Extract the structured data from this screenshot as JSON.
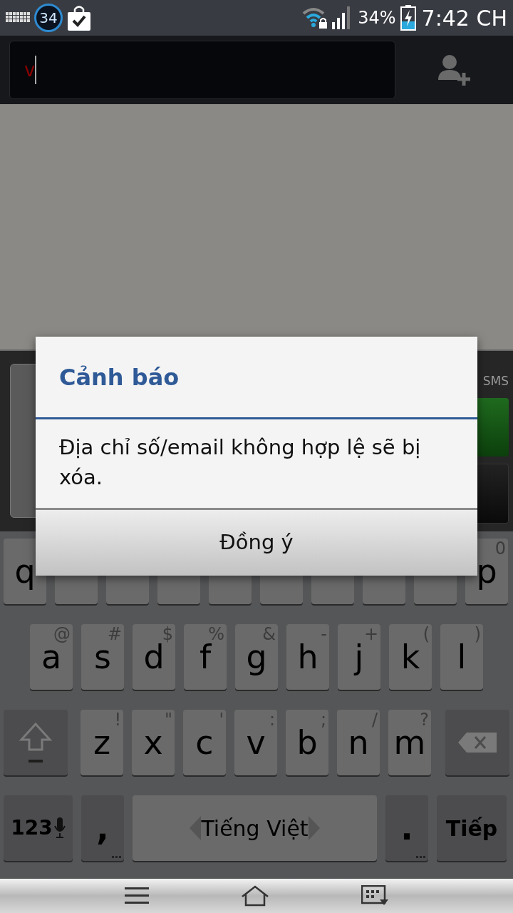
{
  "status_bar": {
    "badge": "34",
    "battery": "34%",
    "time": "7:42 CH"
  },
  "recipient_field": {
    "value": "v"
  },
  "compose": {
    "send_label": "SMS"
  },
  "dialog": {
    "title": "Cảnh báo",
    "message": "Địa chỉ số/email không hợp lệ sẽ bị xóa.",
    "button": "Đồng ý"
  },
  "keyboard": {
    "top_row": {
      "first": {
        "label": "q"
      },
      "last": {
        "label": "p",
        "hint": "0"
      }
    },
    "rows": [
      {
        "keys": [
          {
            "kind": "letter",
            "label": "a",
            "hint": "@"
          },
          {
            "kind": "letter",
            "label": "s",
            "hint": "#"
          },
          {
            "kind": "letter",
            "label": "d",
            "hint": "$"
          },
          {
            "kind": "letter",
            "label": "f",
            "hint": "%"
          },
          {
            "kind": "letter",
            "label": "g",
            "hint": "&"
          },
          {
            "kind": "letter",
            "label": "h",
            "hint": "-"
          },
          {
            "kind": "letter",
            "label": "j",
            "hint": "+"
          },
          {
            "kind": "letter",
            "label": "k",
            "hint": "("
          },
          {
            "kind": "letter",
            "label": "l",
            "hint": ")"
          }
        ]
      },
      {
        "keys": [
          {
            "kind": "shift"
          },
          {
            "kind": "letter",
            "label": "z",
            "hint": "!"
          },
          {
            "kind": "letter",
            "label": "x",
            "hint": "\""
          },
          {
            "kind": "letter",
            "label": "c",
            "hint": "'"
          },
          {
            "kind": "letter",
            "label": "v",
            "hint": ":"
          },
          {
            "kind": "letter",
            "label": "b",
            "hint": ";"
          },
          {
            "kind": "letter",
            "label": "n",
            "hint": "/"
          },
          {
            "kind": "letter",
            "label": "m",
            "hint": "?"
          },
          {
            "kind": "backspace"
          }
        ]
      },
      {
        "keys": [
          {
            "kind": "mode",
            "label": "123"
          },
          {
            "kind": "symbol",
            "label": ","
          },
          {
            "kind": "space",
            "label": "Tiếng Việt"
          },
          {
            "kind": "symbol",
            "label": "."
          },
          {
            "kind": "action",
            "label": "Tiếp"
          }
        ]
      }
    ]
  }
}
